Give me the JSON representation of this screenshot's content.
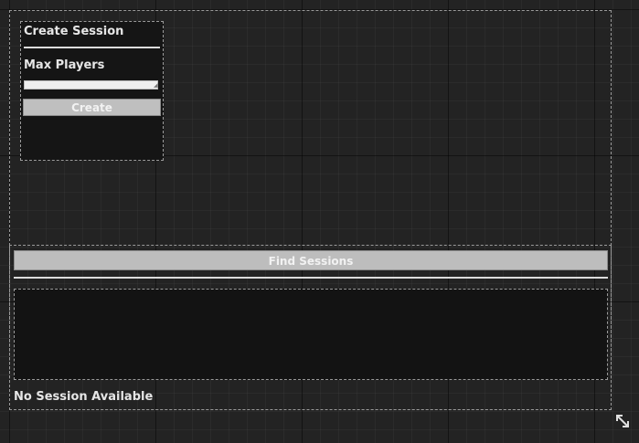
{
  "create_panel": {
    "title": "Create Session",
    "max_players_label": "Max Players",
    "max_players_value": "",
    "create_label": "Create"
  },
  "find_panel": {
    "find_label": "Find Sessions",
    "status": "No Session Available"
  },
  "icons": {
    "resize": "resize-diagonal-icon"
  },
  "colors": {
    "canvas_bg": "#232323",
    "panel_bg": "#151515",
    "button_bg": "#bfbfbf",
    "text": "#e6e6e6"
  }
}
